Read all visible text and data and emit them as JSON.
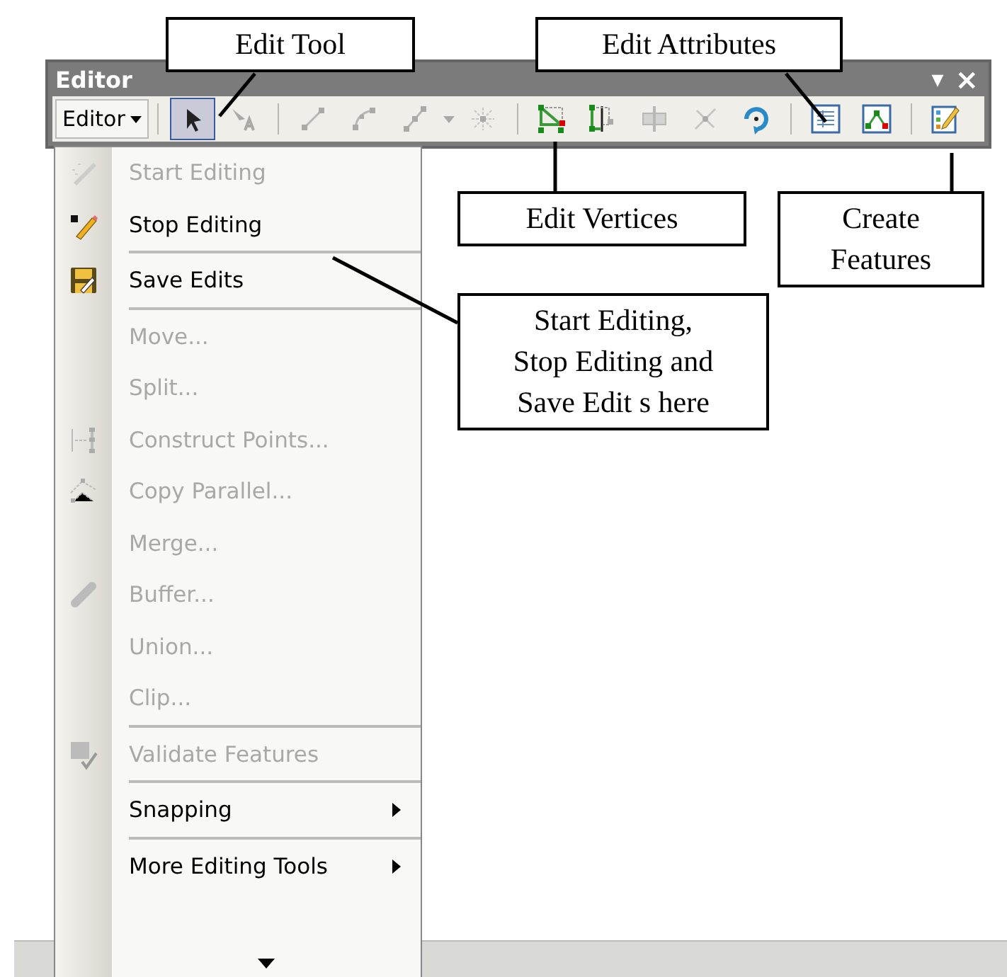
{
  "window": {
    "title": "Editor",
    "dropdown": "Editor",
    "menu_arrow": "▼",
    "close": "×"
  },
  "tools": [
    {
      "kind": "separator"
    },
    {
      "kind": "select",
      "selected": true,
      "disabled": false
    },
    {
      "kind": "annotation",
      "selected": false,
      "disabled": true
    },
    {
      "kind": "separator"
    },
    {
      "kind": "line",
      "selected": false,
      "disabled": true
    },
    {
      "kind": "arc",
      "selected": false,
      "disabled": true
    },
    {
      "kind": "polyline",
      "selected": false,
      "disabled": true
    },
    {
      "kind": "dropdown",
      "selected": false,
      "disabled": true
    },
    {
      "kind": "midpoint",
      "selected": false,
      "disabled": true
    },
    {
      "kind": "separator"
    },
    {
      "kind": "vertices",
      "selected": false,
      "disabled": false
    },
    {
      "kind": "reshape",
      "selected": false,
      "disabled": false
    },
    {
      "kind": "split",
      "selected": false,
      "disabled": true
    },
    {
      "kind": "intersect",
      "selected": false,
      "disabled": true
    },
    {
      "kind": "rotate",
      "selected": false,
      "disabled": false
    },
    {
      "kind": "separator"
    },
    {
      "kind": "attributes",
      "selected": false,
      "disabled": false
    },
    {
      "kind": "sketch",
      "selected": false,
      "disabled": false
    },
    {
      "kind": "separator"
    },
    {
      "kind": "create",
      "selected": false,
      "disabled": false
    }
  ],
  "menu": {
    "items": [
      {
        "kind": "start",
        "label": "Start Editing",
        "disabled": true
      },
      {
        "kind": "stop",
        "label": "Stop Editing",
        "disabled": false
      },
      {
        "kind": "separator"
      },
      {
        "kind": "save",
        "label": "Save Edits",
        "disabled": false
      },
      {
        "kind": "separator"
      },
      {
        "kind": "plain",
        "label": "Move...",
        "disabled": true
      },
      {
        "kind": "plain",
        "label": "Split...",
        "disabled": true
      },
      {
        "kind": "construct",
        "label": "Construct Points...",
        "disabled": true
      },
      {
        "kind": "copy",
        "label": "Copy Parallel...",
        "disabled": true
      },
      {
        "kind": "plain",
        "label": "Merge...",
        "disabled": true
      },
      {
        "kind": "buffer",
        "label": "Buffer...",
        "disabled": true
      },
      {
        "kind": "plain",
        "label": "Union...",
        "disabled": true
      },
      {
        "kind": "plain",
        "label": "Clip...",
        "disabled": true
      },
      {
        "kind": "separator"
      },
      {
        "kind": "validate",
        "label": "Validate Features",
        "disabled": true
      },
      {
        "kind": "separator"
      },
      {
        "kind": "submenu",
        "label": "Snapping",
        "disabled": false
      },
      {
        "kind": "separator"
      },
      {
        "kind": "submenu",
        "label": "More Editing Tools",
        "disabled": false
      }
    ]
  },
  "callouts": [
    {
      "lines": [
        "Edit Tool"
      ]
    },
    {
      "lines": [
        "Edit Attributes"
      ]
    },
    {
      "lines": [
        "Edit Vertices"
      ]
    },
    {
      "lines": [
        "Create",
        "Features"
      ]
    },
    {
      "lines": [
        "Start Editing,",
        "Stop Editing and",
        "Save Edit s here"
      ]
    }
  ]
}
